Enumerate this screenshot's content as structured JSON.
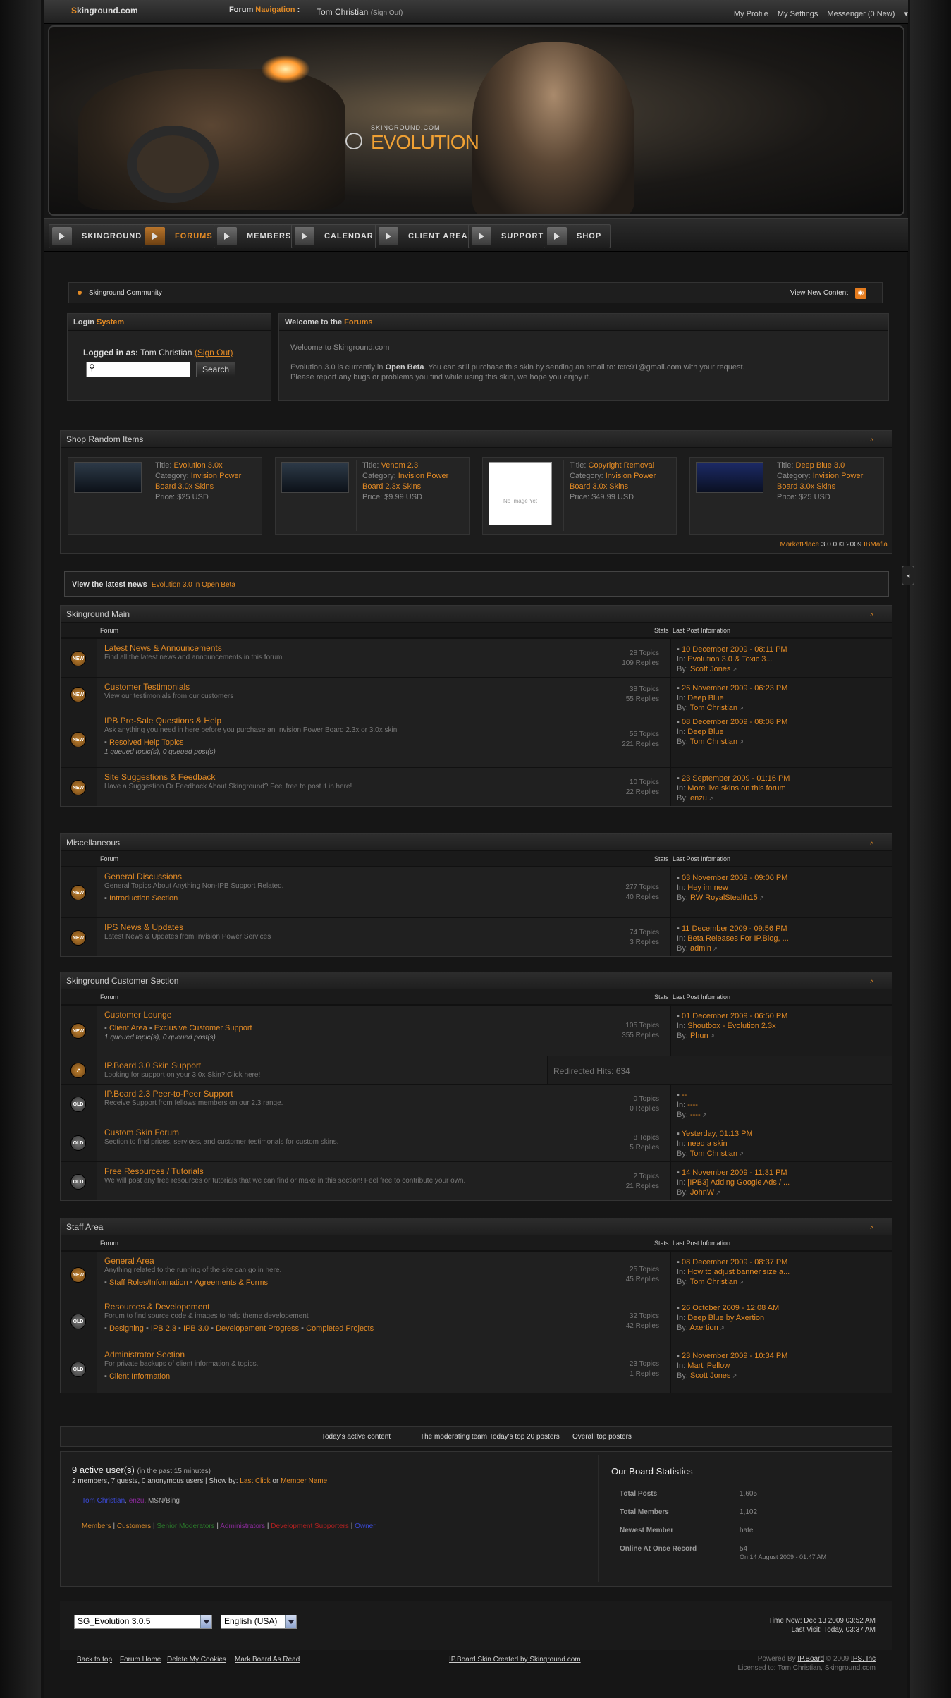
{
  "topbar": {
    "logo_a": "S",
    "logo_b": "kinground.com",
    "forum_nav_a": "Forum",
    "forum_nav_b": "Navigation",
    "forum_nav_c": " :",
    "user_name": "Tom Christian",
    "sign_out": "(Sign Out)",
    "my_profile": "My Profile",
    "my_settings": "My Settings",
    "messenger": "Messenger (0 New)"
  },
  "banner": {
    "site": "SKINGROUND.COM",
    "title": "EVOLUTION"
  },
  "nav": {
    "tabs": [
      "SKINGROUND",
      "FORUMS",
      "MEMBERS",
      "CALENDAR",
      "CLIENT AREA",
      "SUPPORT",
      "SHOP"
    ],
    "active": "FORUMS"
  },
  "breadcrumb": {
    "label": "Skinground Community",
    "view_new": "View New Content"
  },
  "login": {
    "title_a": "Login",
    "title_b": "System",
    "logged_label": "Logged in as:",
    "user": "Tom Christian",
    "sign_out": "(Sign Out)",
    "search_btn": "Search"
  },
  "welcome": {
    "title_a": "Welcome to the",
    "title_b": "Forums",
    "line1": "Welcome to Skinground.com",
    "line2a": "Evolution 3.0 is currently in ",
    "line2b": "Open Beta",
    "line2c": ". You can still purchase this skin by sending an email to: tctc91@gmail.com with your request.",
    "line3": "Please report any bugs or problems you find while using this skin, we hope you enjoy it."
  },
  "shop": {
    "title": "Shop Random Items",
    "items": [
      {
        "title": "Evolution 3.0x",
        "category": "Invision Power Board 3.0x Skins",
        "price": "$25 USD"
      },
      {
        "title": "Venom 2.3",
        "category": "Invision Power Board 2.3x Skins",
        "price": "$9.99 USD"
      },
      {
        "title": "Copyright Removal",
        "category": "Invision Power Board 3.0x Skins",
        "price": "$49.99 USD"
      },
      {
        "title": "Deep Blue 3.0",
        "category": "Invision Power Board 3.0x Skins",
        "price": "$25 USD"
      }
    ],
    "labels": {
      "title": "Title: ",
      "category": "Category: ",
      "price": "Price: "
    },
    "no_image": "No Image Yet",
    "foot_a": "MarketPlace",
    "foot_b": " 3.0.0 © 2009 ",
    "foot_c": "IBMafia"
  },
  "news": {
    "label": "View the latest news",
    "link": "Evolution 3.0 in Open Beta"
  },
  "columns": {
    "forum": "Forum",
    "stats": "Stats",
    "last": "Last Post Infomation"
  },
  "lp_labels": {
    "in": "In: ",
    "by": "By: "
  },
  "cat1": {
    "title": "Skinground Main",
    "rows": [
      {
        "icon": "NEW",
        "title": "Latest News & Announcements",
        "desc": "Find all the latest news and announcements in this forum",
        "topics": "28 Topics",
        "replies": "109 Replies",
        "date": "10 December 2009 - 08:11 PM",
        "in": "Evolution 3.0 & Toxic 3...",
        "by": "Scott Jones"
      },
      {
        "icon": "NEW",
        "title": "Customer Testimonials",
        "desc": "View our testimonials from our customers",
        "topics": "38 Topics",
        "replies": "55 Replies",
        "date": "26 November 2009 - 06:23 PM",
        "in": "Deep Blue",
        "by": "Tom Christian"
      },
      {
        "icon": "NEW",
        "title": "IPB Pre-Sale Questions & Help",
        "desc": "Ask anything you need in here before you purchase an Invision Power Board 2.3x or 3.0x skin",
        "sub": "Resolved Help Topics",
        "queued": "1 queued topic(s), 0 queued post(s)",
        "topics": "55 Topics",
        "replies": "221 Replies",
        "date": "08 December 2009 - 08:08 PM",
        "in": "Deep Blue",
        "by": "Tom Christian"
      },
      {
        "icon": "NEW",
        "title": "Site Suggestions & Feedback",
        "desc": "Have a Suggestion Or Feedback About Skinground? Feel free to post it in here!",
        "topics": "10 Topics",
        "replies": "22 Replies",
        "date": "23 September 2009 - 01:16 PM",
        "in": "More live skins on this forum",
        "by": "enzu"
      }
    ]
  },
  "cat2": {
    "title": "Miscellaneous",
    "rows": [
      {
        "icon": "NEW",
        "title": "General Discussions",
        "desc": "General Topics About Anything Non-IPB Support Related.",
        "sub": "Introduction Section",
        "topics": "277 Topics",
        "replies": "40 Replies",
        "date": "03 November 2009 - 09:00 PM",
        "in": "Hey im new",
        "by": "RW RoyalStealth15"
      },
      {
        "icon": "NEW",
        "title": "IPS News & Updates",
        "desc": "Latest News & Updates from Invision Power Services",
        "topics": "74 Topics",
        "replies": "3 Replies",
        "date": "11 December 2009 - 09:56 PM",
        "in": "Beta Releases For IP.Blog, ...",
        "by": "admin"
      }
    ]
  },
  "cat3": {
    "title": "Skinground Customer Section",
    "rows": [
      {
        "icon": "NEW",
        "title": "Customer Lounge",
        "desc": "",
        "sub": "Client Area",
        "sub2": "Exclusive Customer Support",
        "queued": "1 queued topic(s), 0 queued post(s)",
        "topics": "105 Topics",
        "replies": "355 Replies",
        "date": "01 December 2009 - 06:50 PM",
        "in": "Shoutbox - Evolution 2.3x",
        "by": "Phun"
      },
      {
        "icon": "↗",
        "title": "IP.Board 3.0 Skin Support",
        "desc": "Looking for support on your 3.0x Skin? Click here!",
        "redirect": "Redirected Hits: 634"
      },
      {
        "icon": "OLD",
        "title": "IP.Board 2.3 Peer-to-Peer Support",
        "desc": "Receive Support from fellows members on our 2.3 range.",
        "topics": "0 Topics",
        "replies": "0 Replies",
        "date": "--",
        "in": "----",
        "by": "----"
      },
      {
        "icon": "OLD",
        "title": "Custom Skin Forum",
        "desc": "Section to find prices, services, and customer testimonals for custom skins.",
        "topics": "8 Topics",
        "replies": "5 Replies",
        "date": "Yesterday, 01:13 PM",
        "in": "need a skin",
        "by": "Tom Christian"
      },
      {
        "icon": "OLD",
        "title": "Free Resources / Tutorials",
        "desc": "We will post any free resources or tutorials that we can find or make in this section! Feel free to contribute your own.",
        "topics": "2 Topics",
        "replies": "21 Replies",
        "date": "14 November 2009 - 11:31 PM",
        "in": "[IPB3] Adding Google Ads / ...",
        "by": "JohnW"
      }
    ]
  },
  "cat4": {
    "title": "Staff Area",
    "rows": [
      {
        "icon": "NEW",
        "title": "General Area",
        "desc": "Anything related to the running of the site can go in here.",
        "subs": [
          "Staff Roles/Information",
          "Agreements & Forms"
        ],
        "topics": "25 Topics",
        "replies": "45 Replies",
        "date": "08 December 2009 - 08:37 PM",
        "in": "How to adjust banner size a...",
        "by": "Tom Christian"
      },
      {
        "icon": "OLD",
        "title": "Resources & Developement",
        "desc": "Forum to find source code & images to help theme developement",
        "subs": [
          "Designing",
          "IPB 2.3",
          "IPB 3.0",
          "Developement Progress",
          "Completed Projects"
        ],
        "topics": "32 Topics",
        "replies": "42 Replies",
        "date": "26 October 2009 - 12:08 AM",
        "in": "Deep Blue by Axertion",
        "by": "Axertion"
      },
      {
        "icon": "OLD",
        "title": "Administrator Section",
        "desc": "For private backups of client information & topics.",
        "subs": [
          "Client Information"
        ],
        "topics": "23 Topics",
        "replies": "1 Replies",
        "date": "23 November 2009 - 10:34 PM",
        "in": "Marti Pellow",
        "by": "Scott Jones"
      }
    ]
  },
  "toptabs": [
    "Today's active content",
    "The moderating team",
    "Today's top 20 posters",
    "Overall top posters"
  ],
  "active_users": {
    "title": "9 active user(s)",
    "sub": "(in the past 15 minutes)",
    "line": "2 members, 7 guests, 0 anonymous users | Show by: ",
    "last_click": "Last Click",
    "or": " or ",
    "member_name": "Member Name",
    "names": [
      {
        "n": "Tom Christian",
        "c": "#3a49d6"
      },
      {
        "n": ", "
      },
      {
        "n": "enzu",
        "c": "#8a2a9a"
      },
      {
        "n": ", MSN/Bing",
        "c": "#aaa"
      }
    ],
    "groups": [
      {
        "n": "Members",
        "c": "#d8892a"
      },
      {
        "n": "Customers",
        "c": "#d8892a"
      },
      {
        "n": "Senior Moderators",
        "c": "#2a7a2a"
      },
      {
        "n": "Administrators",
        "c": "#8a2a9a"
      },
      {
        "n": "Development Supporters",
        "c": "#b02020"
      },
      {
        "n": "Owner",
        "c": "#3a49d6"
      }
    ]
  },
  "board_stats": {
    "title": "Our Board Statistics",
    "rows": [
      {
        "k": "Total Posts",
        "v": "1,605"
      },
      {
        "k": "Total Members",
        "v": "1,102"
      },
      {
        "k": "Newest Member",
        "v": "hate"
      },
      {
        "k": "Online At Once Record",
        "v": "54",
        "v2": "On 14 August 2009 - 01:47 AM"
      }
    ]
  },
  "bottom": {
    "skin": "SG_Evolution 3.0.5",
    "lang": "English (USA)",
    "time_now": "Time Now: Dec 13 2009 03:52 AM",
    "last_visit": "Last Visit: Today, 03:37 AM",
    "links": [
      "Back to top",
      "Forum Home",
      "Delete My Cookies",
      "Mark Board As Read"
    ],
    "credit": "IP.Board Skin Created by Skinground.com",
    "powered_a": "Powered By ",
    "powered_b": "IP.Board",
    "powered_c": " © 2009  ",
    "powered_d": "IPS, Inc",
    "licensed": "Licensed to: Tom Christian, Skinground.com"
  }
}
